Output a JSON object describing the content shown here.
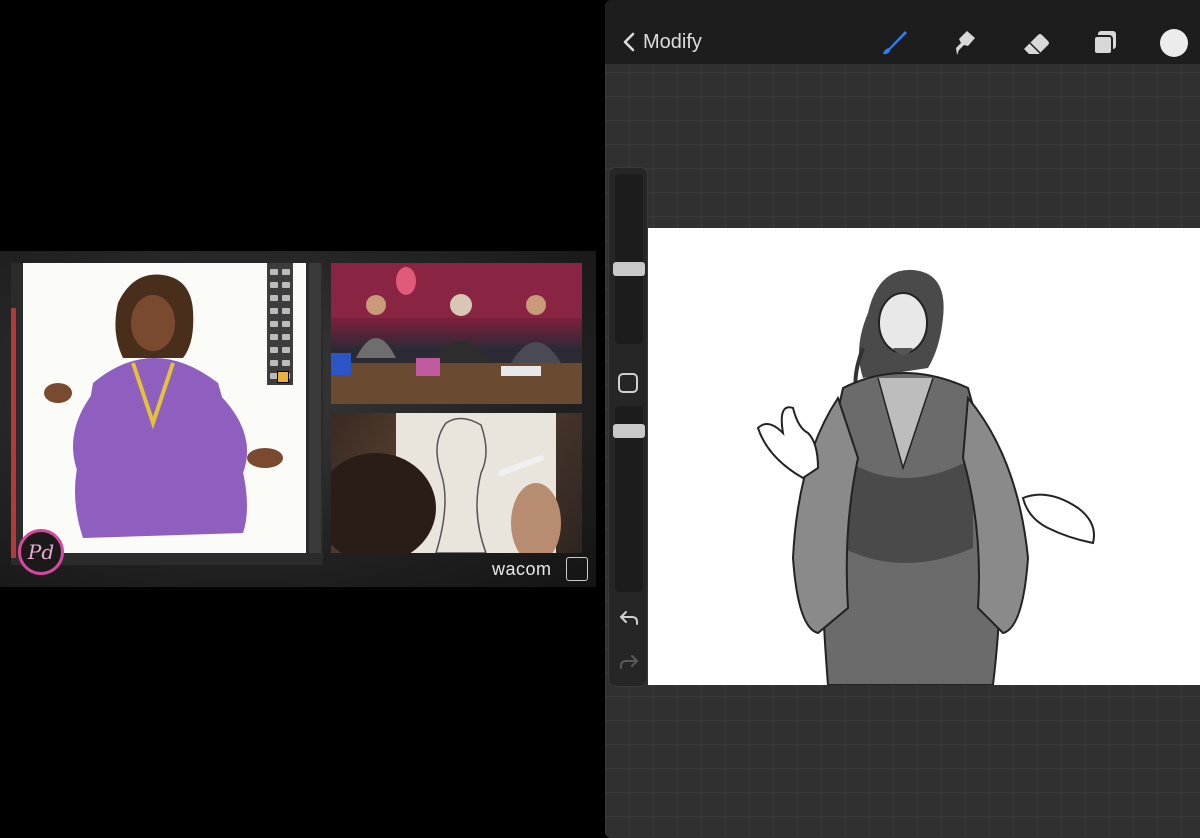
{
  "left_video": {
    "logo_text": "Pd",
    "sponsor": "wacom"
  },
  "procreate": {
    "back_label": "Modify",
    "tools": [
      "brush-icon",
      "smudge-icon",
      "eraser-icon",
      "layers-icon",
      "color-icon"
    ],
    "accent": "#2f7cf6",
    "current_color": "#ececec"
  }
}
